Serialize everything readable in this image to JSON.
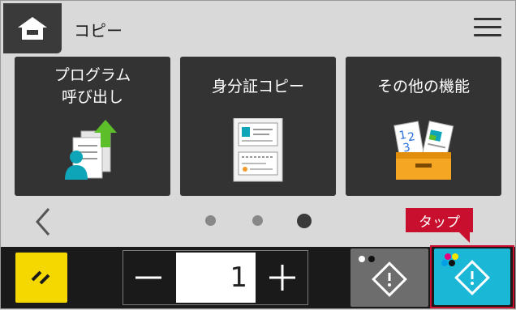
{
  "header": {
    "title": "コピー"
  },
  "tiles": [
    {
      "label_line1": "プログラム",
      "label_line2": "呼び出し"
    },
    {
      "label_line1": "身分証コピー"
    },
    {
      "label_line1": "その他の機能"
    }
  ],
  "pager": {
    "pages": 3,
    "active_page": 3
  },
  "callout": {
    "text": "タップ"
  },
  "bottom": {
    "quantity": "1"
  },
  "colors": {
    "background": "#d9d9d9",
    "tile": "#333333",
    "bottom_bar": "#1a1a1a",
    "reset": "#f5d800",
    "bw_start": "#6d6d6d",
    "color_start": "#1bb7d6",
    "callout": "#c8102e"
  },
  "icons": [
    "home-icon",
    "menu-icon",
    "program-recall-icon",
    "id-card-copy-icon",
    "other-functions-icon",
    "chevron-left-icon",
    "reset-icon",
    "minus-icon",
    "plus-icon",
    "bw-start-icon",
    "color-start-icon"
  ]
}
